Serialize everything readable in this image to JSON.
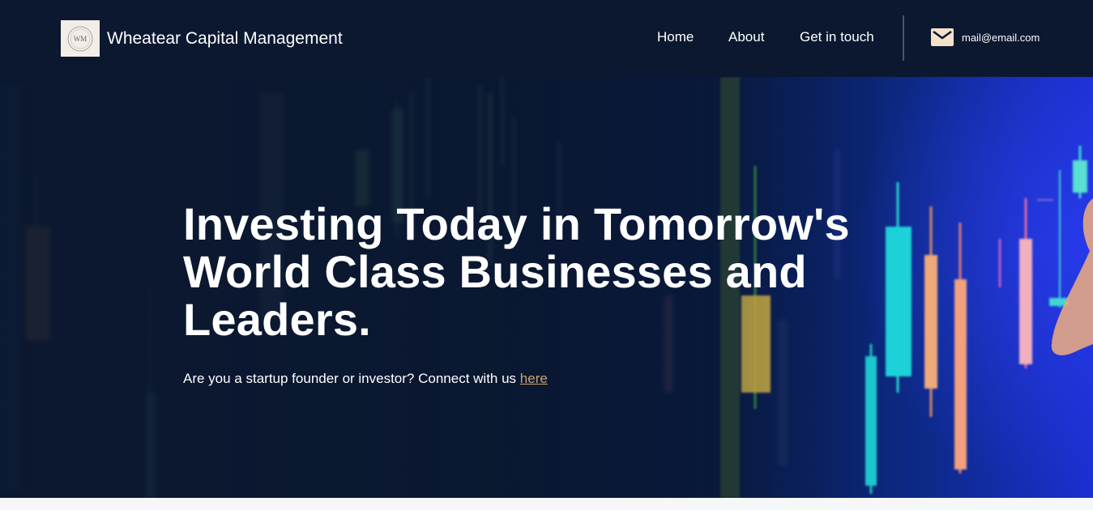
{
  "header": {
    "brand_name": "Wheatear Capital Management",
    "logo_text": "WM",
    "nav": [
      {
        "label": "Home"
      },
      {
        "label": "About"
      },
      {
        "label": "Get in touch"
      }
    ],
    "contact_email": "mail@email.com",
    "contact_icon": "envelope-icon"
  },
  "hero": {
    "title": "Investing Today in Tomorrow's World Class Businesses and Leaders.",
    "subtitle_prefix": "Are you a startup founder or investor? Connect with us ",
    "subtitle_link": "here",
    "link_color": "#c9a66b"
  },
  "colors": {
    "header_bg": "#0b1830",
    "text": "#ffffff",
    "page_bg": "#f6f7f9"
  }
}
